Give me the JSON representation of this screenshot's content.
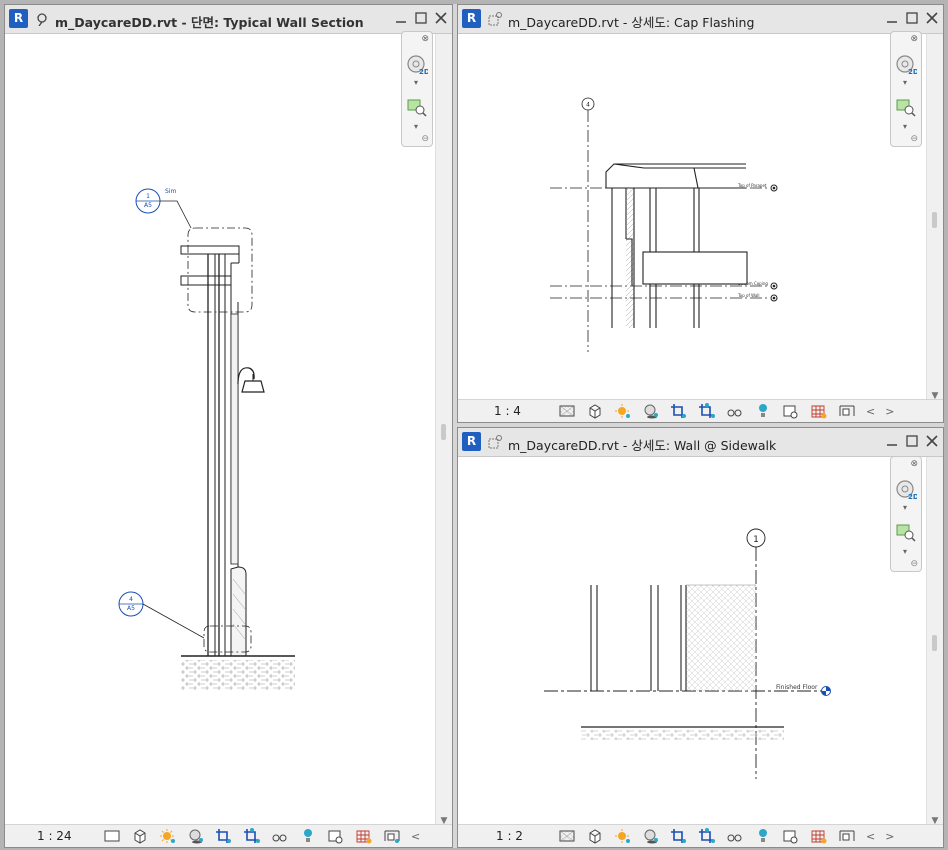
{
  "windows": [
    {
      "title": "m_DaycareDD.rvt - 단면: Typical Wall Section",
      "scale": "1 : 24"
    },
    {
      "title": "m_DaycareDD.rvt - 상세도: Cap Flashing",
      "scale": "1 : 4"
    },
    {
      "title": "m_DaycareDD.rvt - 상세도: Wall @ Sidewalk",
      "scale": "1 : 2"
    }
  ],
  "logo": "R",
  "section_view": {
    "callout_top": {
      "number": "1",
      "sheet": "A5",
      "note": "Sim"
    },
    "callout_bottom": {
      "number": "4",
      "sheet": "A5"
    }
  },
  "cap_flashing_view": {
    "grid": "4",
    "levels": [
      "Top of Parapet",
      "Bottom Coping",
      "Top of Wall"
    ]
  },
  "sidewalk_view": {
    "grid": "1",
    "level": "Finished Floor"
  },
  "navbar": {
    "close": "⊗",
    "two_d": "2D",
    "dropdown": "▾",
    "collapse": "⊖"
  },
  "colors": {
    "revit_blue": "#1f5fbf",
    "annotation_blue": "#1a4fb3",
    "sun": "#f5a623",
    "light": "#2aa7c9"
  }
}
